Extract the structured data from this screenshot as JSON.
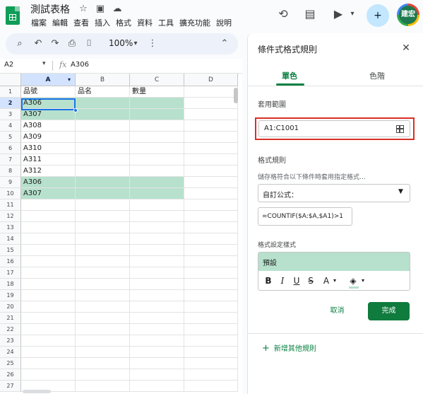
{
  "app": {
    "title": "測試表格",
    "menu": [
      "檔案",
      "編輯",
      "查看",
      "插入",
      "格式",
      "資料",
      "工具",
      "擴充功能",
      "說明"
    ],
    "avatar_label": "建宏"
  },
  "toolbar": {
    "zoom": "100%"
  },
  "formula_bar": {
    "cell_ref": "A2",
    "fx": "fx",
    "value": "A306"
  },
  "grid": {
    "columns": [
      "A",
      "B",
      "C",
      "D"
    ],
    "selected_column": "A",
    "header_row": [
      "品號",
      "品名",
      "數量"
    ],
    "rows": [
      {
        "num": "1",
        "a": "品號",
        "b": "品名",
        "c": "數量",
        "hl": false
      },
      {
        "num": "2",
        "a": "A306",
        "b": "",
        "c": "",
        "hl": true
      },
      {
        "num": "3",
        "a": "A307",
        "b": "",
        "c": "",
        "hl": true
      },
      {
        "num": "4",
        "a": "A308",
        "b": "",
        "c": "",
        "hl": false
      },
      {
        "num": "5",
        "a": "A309",
        "b": "",
        "c": "",
        "hl": false
      },
      {
        "num": "6",
        "a": "A310",
        "b": "",
        "c": "",
        "hl": false
      },
      {
        "num": "7",
        "a": "A311",
        "b": "",
        "c": "",
        "hl": false
      },
      {
        "num": "8",
        "a": "A312",
        "b": "",
        "c": "",
        "hl": false
      },
      {
        "num": "9",
        "a": "A306",
        "b": "",
        "c": "",
        "hl": true
      },
      {
        "num": "10",
        "a": "A307",
        "b": "",
        "c": "",
        "hl": true
      },
      {
        "num": "11",
        "a": "",
        "b": "",
        "c": "",
        "hl": false
      },
      {
        "num": "12",
        "a": "",
        "b": "",
        "c": "",
        "hl": false
      },
      {
        "num": "13",
        "a": "",
        "b": "",
        "c": "",
        "hl": false
      },
      {
        "num": "14",
        "a": "",
        "b": "",
        "c": "",
        "hl": false
      },
      {
        "num": "15",
        "a": "",
        "b": "",
        "c": "",
        "hl": false
      },
      {
        "num": "16",
        "a": "",
        "b": "",
        "c": "",
        "hl": false
      },
      {
        "num": "17",
        "a": "",
        "b": "",
        "c": "",
        "hl": false
      },
      {
        "num": "18",
        "a": "",
        "b": "",
        "c": "",
        "hl": false
      },
      {
        "num": "19",
        "a": "",
        "b": "",
        "c": "",
        "hl": false
      },
      {
        "num": "20",
        "a": "",
        "b": "",
        "c": "",
        "hl": false
      },
      {
        "num": "21",
        "a": "",
        "b": "",
        "c": "",
        "hl": false
      },
      {
        "num": "22",
        "a": "",
        "b": "",
        "c": "",
        "hl": false
      },
      {
        "num": "23",
        "a": "",
        "b": "",
        "c": "",
        "hl": false
      },
      {
        "num": "24",
        "a": "",
        "b": "",
        "c": "",
        "hl": false
      },
      {
        "num": "25",
        "a": "",
        "b": "",
        "c": "",
        "hl": false
      },
      {
        "num": "26",
        "a": "",
        "b": "",
        "c": "",
        "hl": false
      },
      {
        "num": "27",
        "a": "",
        "b": "",
        "c": "",
        "hl": false
      }
    ],
    "highlight_color": "#b7e1cd"
  },
  "panel": {
    "title": "條件式格式規則",
    "tabs": [
      "單色",
      "色階"
    ],
    "range_label": "套用範圍",
    "range_value": "A1:C1001",
    "rules_label": "格式規則",
    "rules_hint": "儲存格符合以下條件時套用指定格式…",
    "condition": "自訂公式：",
    "formula": "=COUNTIF($A:$A,$A1)>1",
    "style_label": "格式設定樣式",
    "style_preview": "預設",
    "format_buttons": [
      "B",
      "I",
      "U",
      "S",
      "A"
    ],
    "cancel": "取消",
    "done": "完成",
    "add_rule": "新增其他規則",
    "accent": "#0b8043"
  }
}
